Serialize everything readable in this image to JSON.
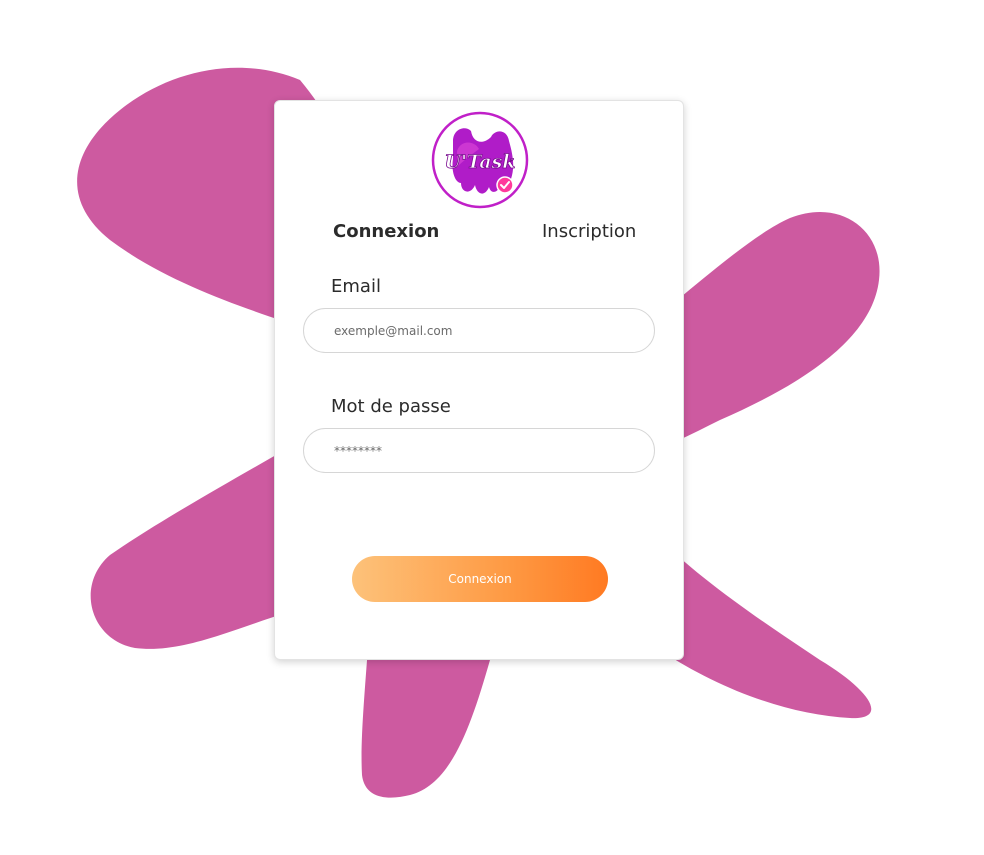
{
  "logo": {
    "text": "U'Task"
  },
  "tabs": {
    "login": "Connexion",
    "register": "Inscription"
  },
  "form": {
    "email_label": "Email",
    "email_placeholder": "exemple@mail.com",
    "password_label": "Mot de passe",
    "password_placeholder": "********",
    "submit_label": "Connexion"
  },
  "colors": {
    "blob": "#cd5aa0",
    "button_start": "#fdc27a",
    "button_end": "#ff7a22",
    "logo_ring": "#c020c8"
  }
}
